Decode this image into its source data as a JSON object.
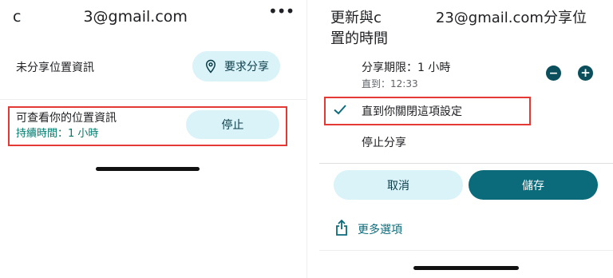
{
  "left": {
    "title_prefix": "c",
    "title_suffix": "3@gmail.com",
    "more_label": "•••",
    "unshared_label": "未分享位置資訊",
    "request_label": "要求分享",
    "viewer_title": "可查看你的位置資訊",
    "viewer_duration": "持續時間：1 小時",
    "stop_label": "停止"
  },
  "right": {
    "title_part1": "更新與c",
    "title_part2": "23@gmail.com分享位",
    "title_line2": "置的時間",
    "period_title": "分享期限：1 小時",
    "period_until": "直到：12:33",
    "minus_label": "−",
    "plus_label": "+",
    "until_off_label": "直到你關閉這項設定",
    "stop_share_label": "停止分享",
    "cancel_label": "取消",
    "save_label": "儲存",
    "more_options_label": "更多選項"
  },
  "colors": {
    "accent": "#0b6b7a",
    "chip_bg": "#d9f3f8",
    "highlight_border": "#e53935",
    "duration_text": "#00796b"
  }
}
